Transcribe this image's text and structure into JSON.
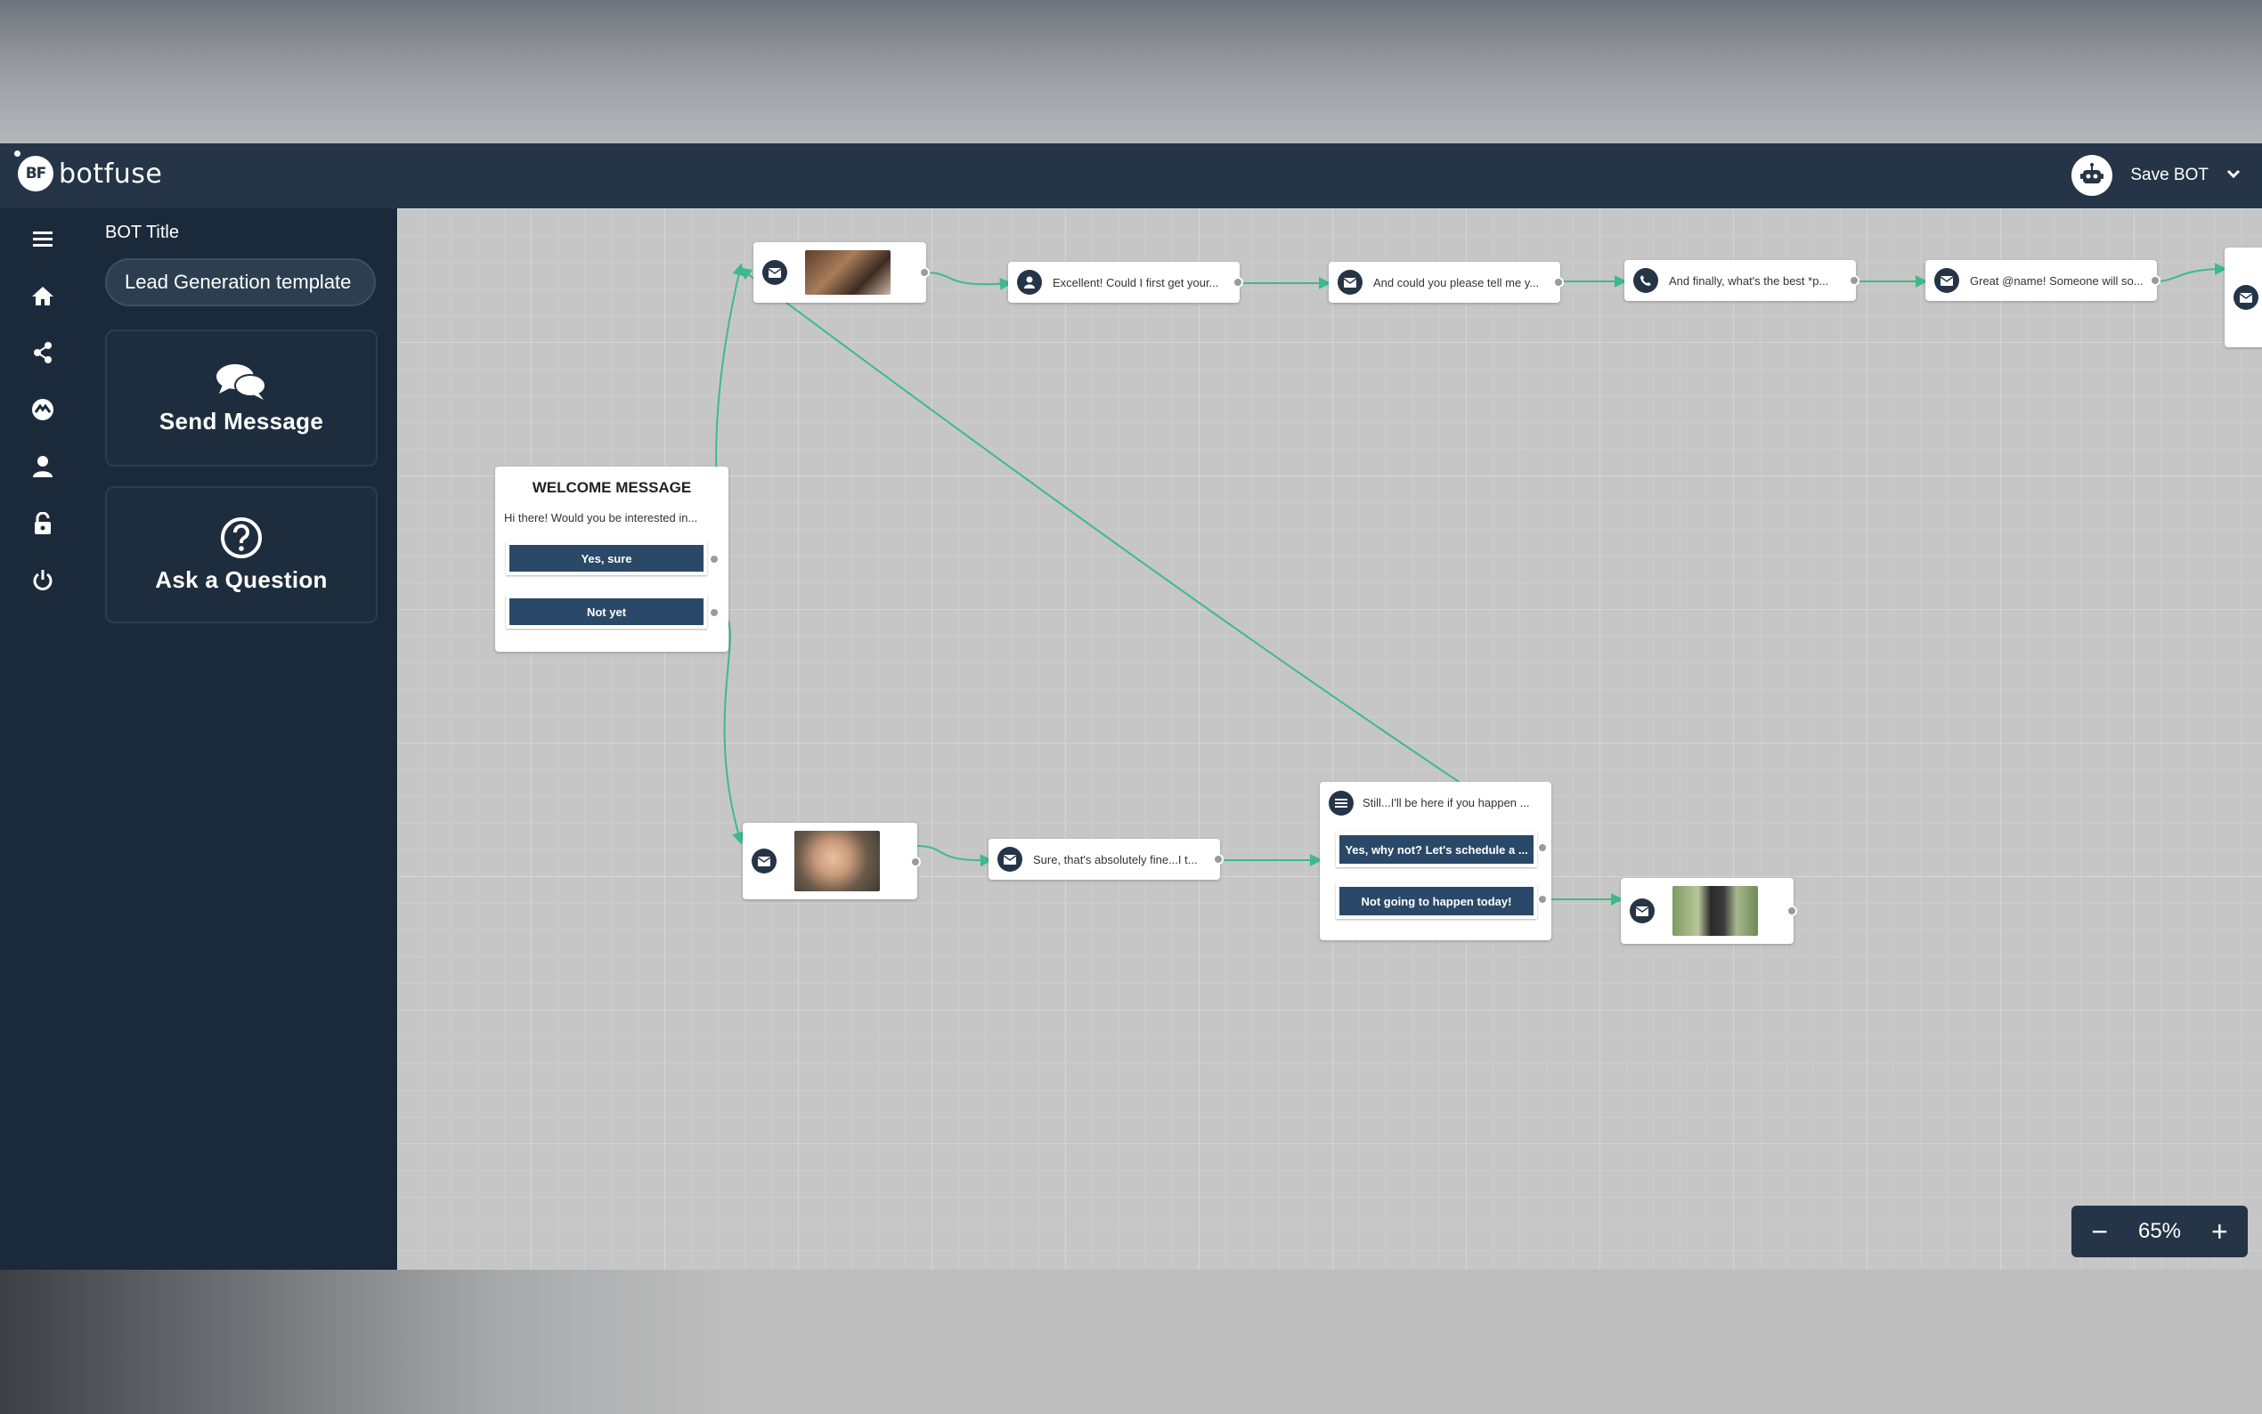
{
  "app": {
    "name": "botfuse",
    "logo_initials": "BF"
  },
  "header": {
    "save_label": "Save BOT"
  },
  "panel": {
    "bot_title_label": "BOT Title",
    "bot_title_value": "Lead Generation template",
    "tools": [
      {
        "label": "Send Message",
        "icon": "chat-bubbles-icon"
      },
      {
        "label": "Ask a Question",
        "icon": "question-circle-icon"
      }
    ]
  },
  "sidebar_icons": [
    "menu-icon",
    "home-icon",
    "share-icon",
    "dashboard-icon",
    "user-icon",
    "lock-icon",
    "power-icon"
  ],
  "flow": {
    "welcome": {
      "title": "WELCOME MESSAGE",
      "text": "Hi there! Would you be interested in...",
      "options": [
        "Yes, sure",
        "Not yet"
      ]
    },
    "top_row": [
      "Excellent! Could I first get your...",
      "And could you please tell me y...",
      "And finally, what's the best *p...",
      "Great @name! Someone will so..."
    ],
    "bottom_msg": "Sure, that's absolutely fine...I t...",
    "question": {
      "text": "Still...I'll be here if you happen ...",
      "options": [
        "Yes, why not? Let's schedule a ...",
        "Not going to happen today!"
      ]
    }
  },
  "zoom": {
    "value": "65%",
    "minus": "−",
    "plus": "+"
  },
  "colors": {
    "header": "#253547",
    "sidebar": "#1b2a3a",
    "button": "#2a4868",
    "connector": "#3dba8c"
  }
}
